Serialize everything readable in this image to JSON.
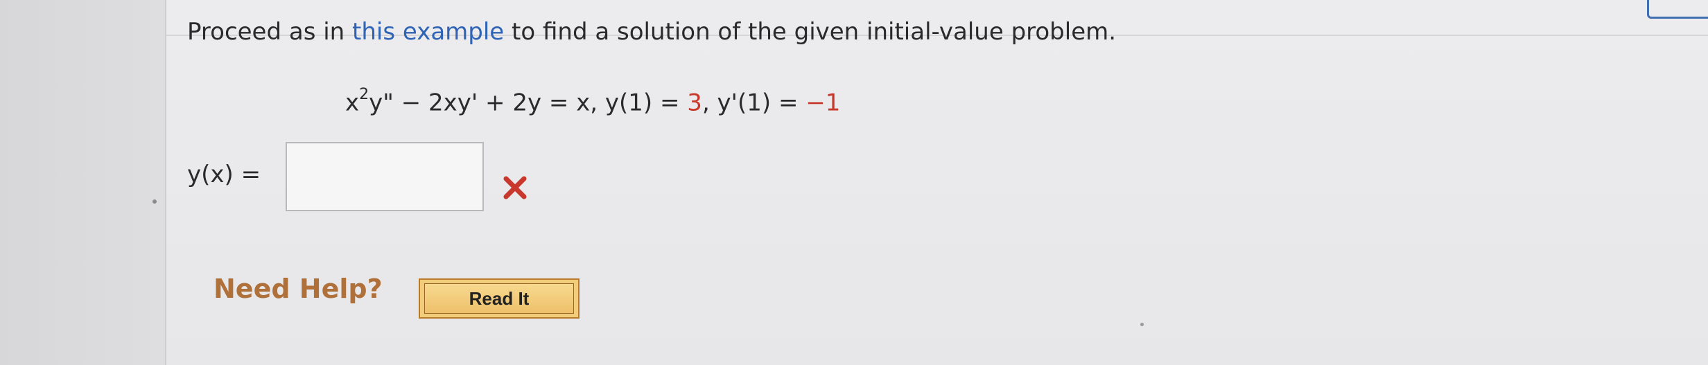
{
  "question": {
    "prefix": "Proceed as in ",
    "link_text": "this example",
    "suffix": " to find a solution of the given initial-value problem."
  },
  "equation": {
    "part1": "x",
    "exp": "2",
    "part2": "y\" − 2xy' + 2y = x, y(1) = ",
    "val1": "3",
    "part3": ", y'(1) = ",
    "val2": "−1"
  },
  "answer": {
    "label": "y(x) =",
    "value": "",
    "status": "incorrect"
  },
  "help": {
    "label": "Need Help?",
    "button_label": "Read It"
  },
  "colors": {
    "link": "#2f63b5",
    "value_red": "#c8382c",
    "wrong_mark": "#c8382c",
    "help_text": "#b0703a",
    "button_fill": "#f1cc7a",
    "accent_box": "#3f6fb2"
  },
  "icons": {
    "wrong": "x-mark-icon"
  }
}
